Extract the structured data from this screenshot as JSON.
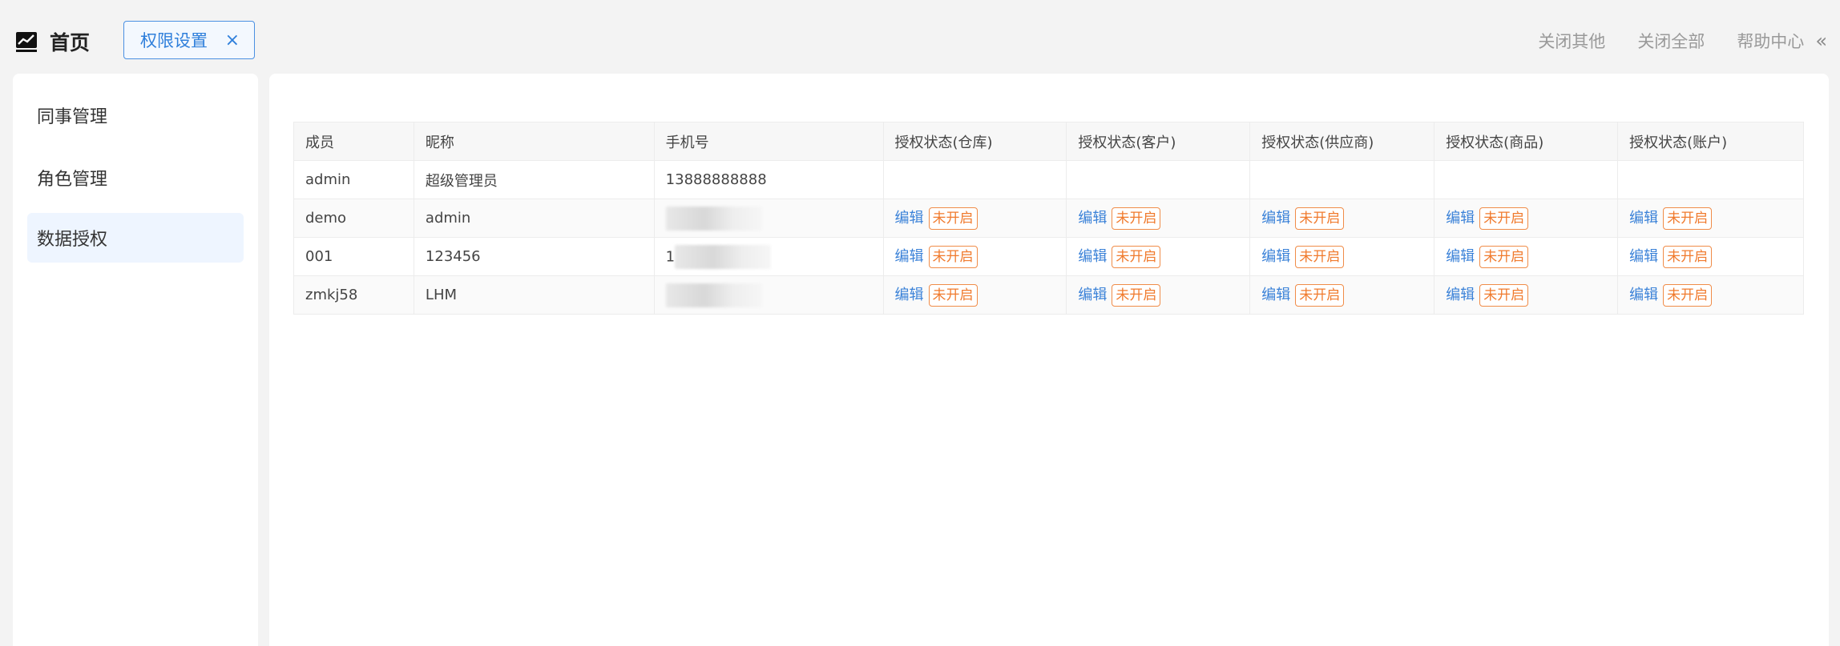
{
  "header": {
    "home_label": "首页",
    "tab_label": "权限设置",
    "tab_close": "×",
    "actions": [
      "关闭其他",
      "关闭全部",
      "帮助中心"
    ],
    "collapse": "«"
  },
  "sidebar": {
    "items": [
      {
        "label": "同事管理"
      },
      {
        "label": "角色管理"
      },
      {
        "label": "数据授权"
      }
    ],
    "active": "数据授权"
  },
  "table": {
    "columns": [
      "成员",
      "昵称",
      "手机号",
      "授权状态(仓库)",
      "授权状态(客户)",
      "授权状态(供应商)",
      "授权状态(商品)",
      "授权状态(账户)"
    ],
    "edit_label": "编辑",
    "status_label": "未开启",
    "rows": [
      {
        "member": "admin",
        "nickname": "超级管理员",
        "phone": "13888888888"
      },
      {
        "member": "demo",
        "nickname": "admin",
        "phone": ""
      },
      {
        "member": "001",
        "nickname": "123456",
        "phone": "1"
      },
      {
        "member": "zmkj58",
        "nickname": "LHM",
        "phone": ""
      }
    ]
  },
  "colors": {
    "accent": "#2f7fdb",
    "status_orange": "#f07a2d"
  }
}
